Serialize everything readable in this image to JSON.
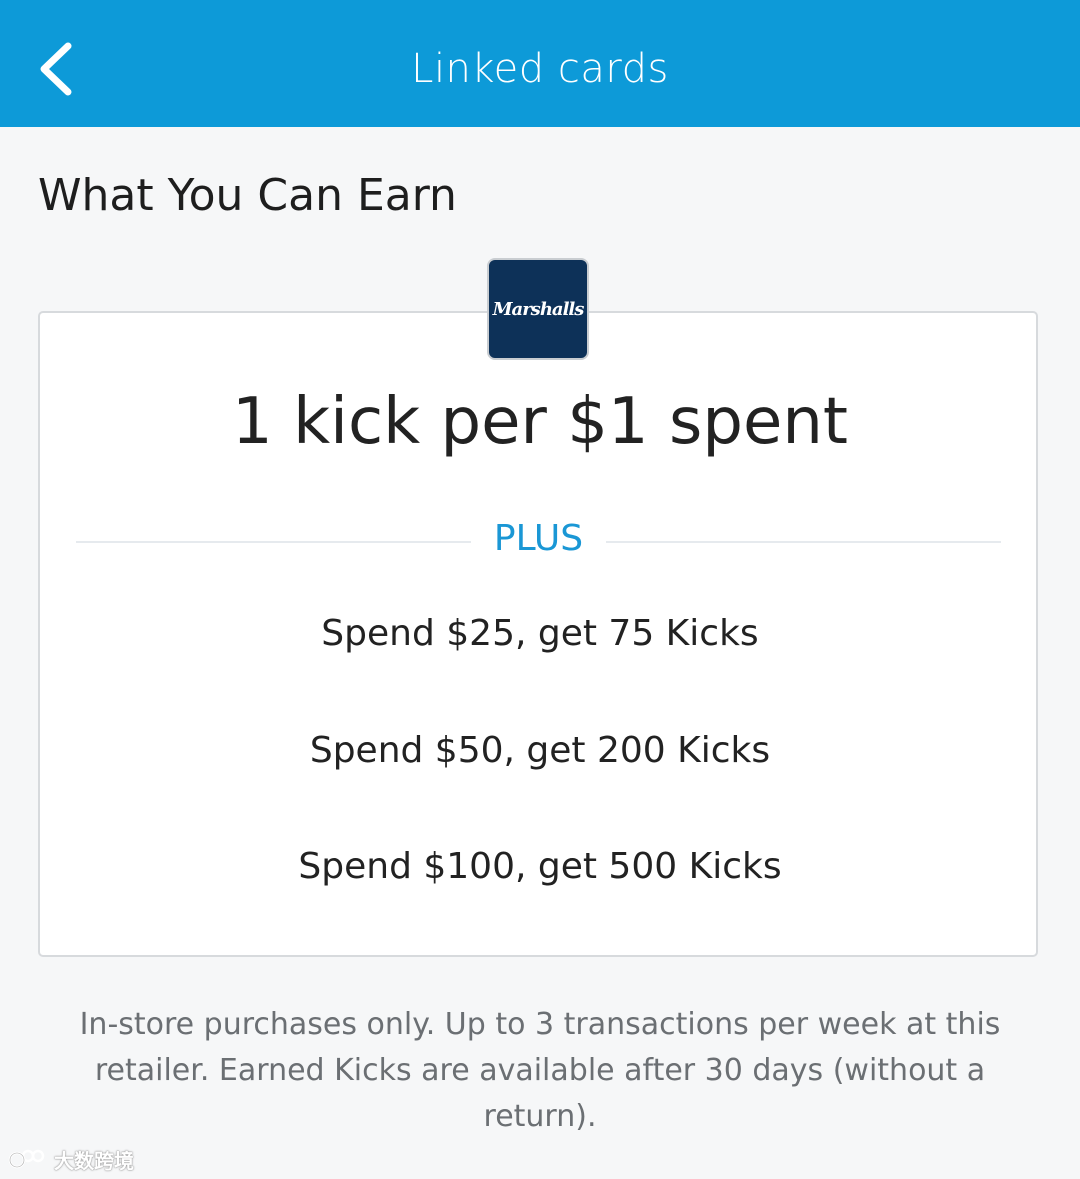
{
  "header": {
    "title": "Linked cards",
    "back_icon": "chevron-left-icon",
    "color": "#0d9ad8"
  },
  "section": {
    "title": "What You Can Earn"
  },
  "card": {
    "retailer_logo_text": "Marshalls",
    "base_rate": "1 kick per $1 spent",
    "plus_label": "PLUS",
    "accent_color": "#1a97d5",
    "offers": [
      "Spend $25, get 75 Kicks",
      "Spend $50, get 200 Kicks",
      "Spend $100, get 500 Kicks"
    ]
  },
  "disclaimer": "In-store purchases only. Up to 3 transactions per week at this retailer. Earned Kicks are available after 30 days (without a return).",
  "watermark": {
    "text": "大数跨境"
  }
}
